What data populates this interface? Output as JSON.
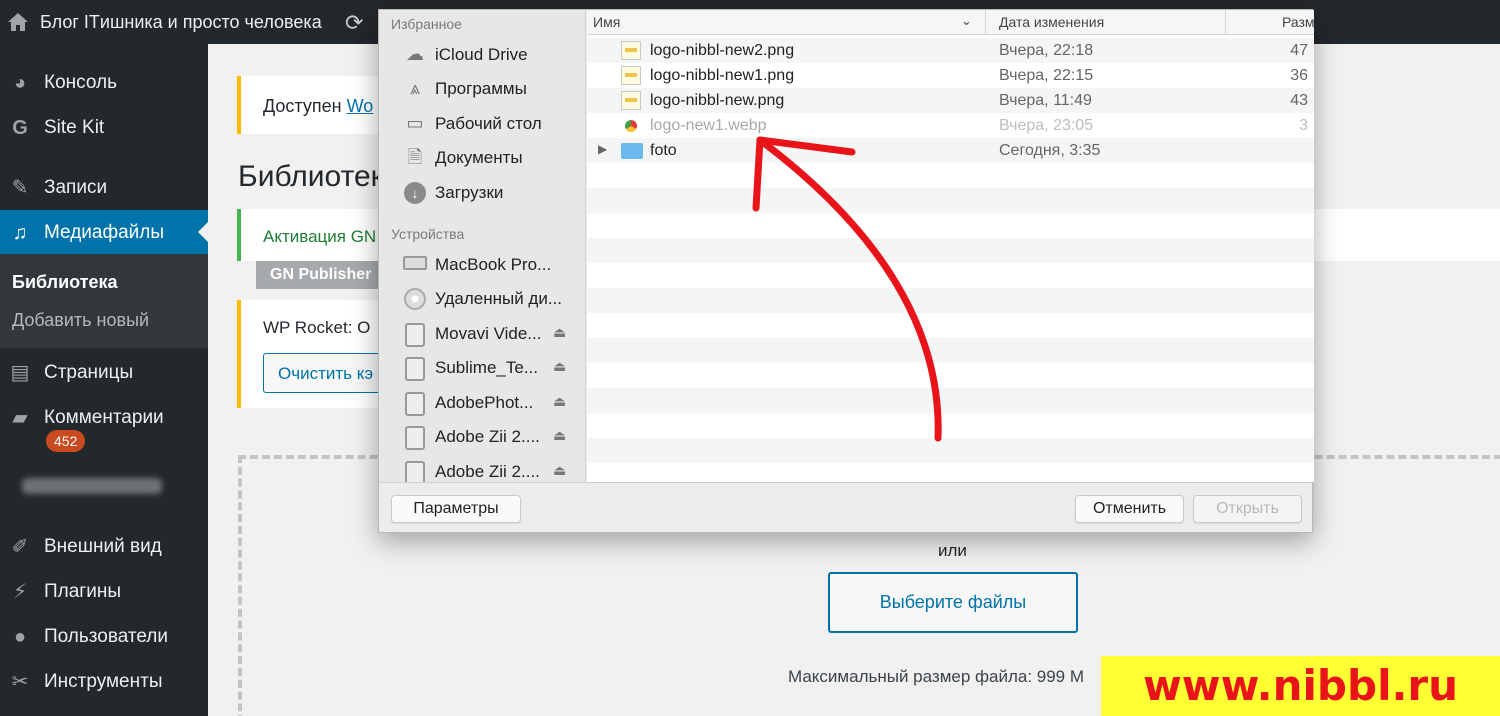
{
  "adminbar": {
    "site_title": "Блог ITишника и просто человека"
  },
  "sidebar": {
    "items": [
      {
        "label": "Консоль",
        "icon": "dashboard-icon"
      },
      {
        "label": "Site Kit",
        "icon": "google-g-icon"
      },
      {
        "label": "Записи",
        "icon": "pin-icon"
      },
      {
        "label": "Медиафайлы",
        "icon": "media-icon"
      },
      {
        "label": "Страницы",
        "icon": "pages-icon"
      },
      {
        "label": "Комментарии",
        "icon": "comment-icon"
      },
      {
        "label": "Внешний вид",
        "icon": "brush-icon"
      },
      {
        "label": "Плагины",
        "icon": "plugin-icon"
      },
      {
        "label": "Пользователи",
        "icon": "user-icon"
      },
      {
        "label": "Инструменты",
        "icon": "wrench-icon"
      }
    ],
    "submenu": {
      "current": "Библиотека",
      "add_new": "Добавить новый"
    },
    "comments_badge": "452"
  },
  "main": {
    "notice_update_prefix": "Доступен ",
    "notice_update_link": "Wo",
    "page_title": "Библиотек",
    "notice_activation": "Активация GN",
    "gn_tag": "GN Publisher",
    "notice_rocket": "WP Rocket: О",
    "clear_cache_button": "Очистить кэ",
    "or_text": "или",
    "select_files_button": "Выберите файлы",
    "max_size": "Максимальный размер файла: 999 М"
  },
  "dialog": {
    "favorites_heading": "Избранное",
    "favorites": [
      "iCloud Drive",
      "Программы",
      "Рабочий стол",
      "Документы",
      "Загрузки"
    ],
    "devices_heading": "Устройства",
    "devices": [
      "MacBook Pro...",
      "Удаленный ди...",
      "Movavi Vide...",
      "Sublime_Te...",
      "AdobePhot...",
      "Adobe Zii 2....",
      "Adobe Zii 2...."
    ],
    "columns": {
      "name": "Имя",
      "date": "Дата изменения",
      "size": "Разм"
    },
    "files": [
      {
        "name": "logo-nibbl-new2.png",
        "date": "Вчера, 22:18",
        "size": "47"
      },
      {
        "name": "logo-nibbl-new1.png",
        "date": "Вчера, 22:15",
        "size": "36"
      },
      {
        "name": "logo-nibbl-new.png",
        "date": "Вчера, 11:49",
        "size": "43"
      },
      {
        "name": "logo-new1.webp",
        "date": "Вчера, 23:05",
        "size": "3"
      },
      {
        "name": "foto",
        "date": "Сегодня, 3:35",
        "size": ""
      }
    ],
    "params_button": "Параметры",
    "cancel_button": "Отменить",
    "open_button": "Открыть"
  },
  "watermark": "www.nibbl.ru",
  "colors": {
    "accent": "#0073aa",
    "adminbar": "#23282d",
    "arrow": "#e8141a",
    "watermark_bg": "#ffff33"
  }
}
